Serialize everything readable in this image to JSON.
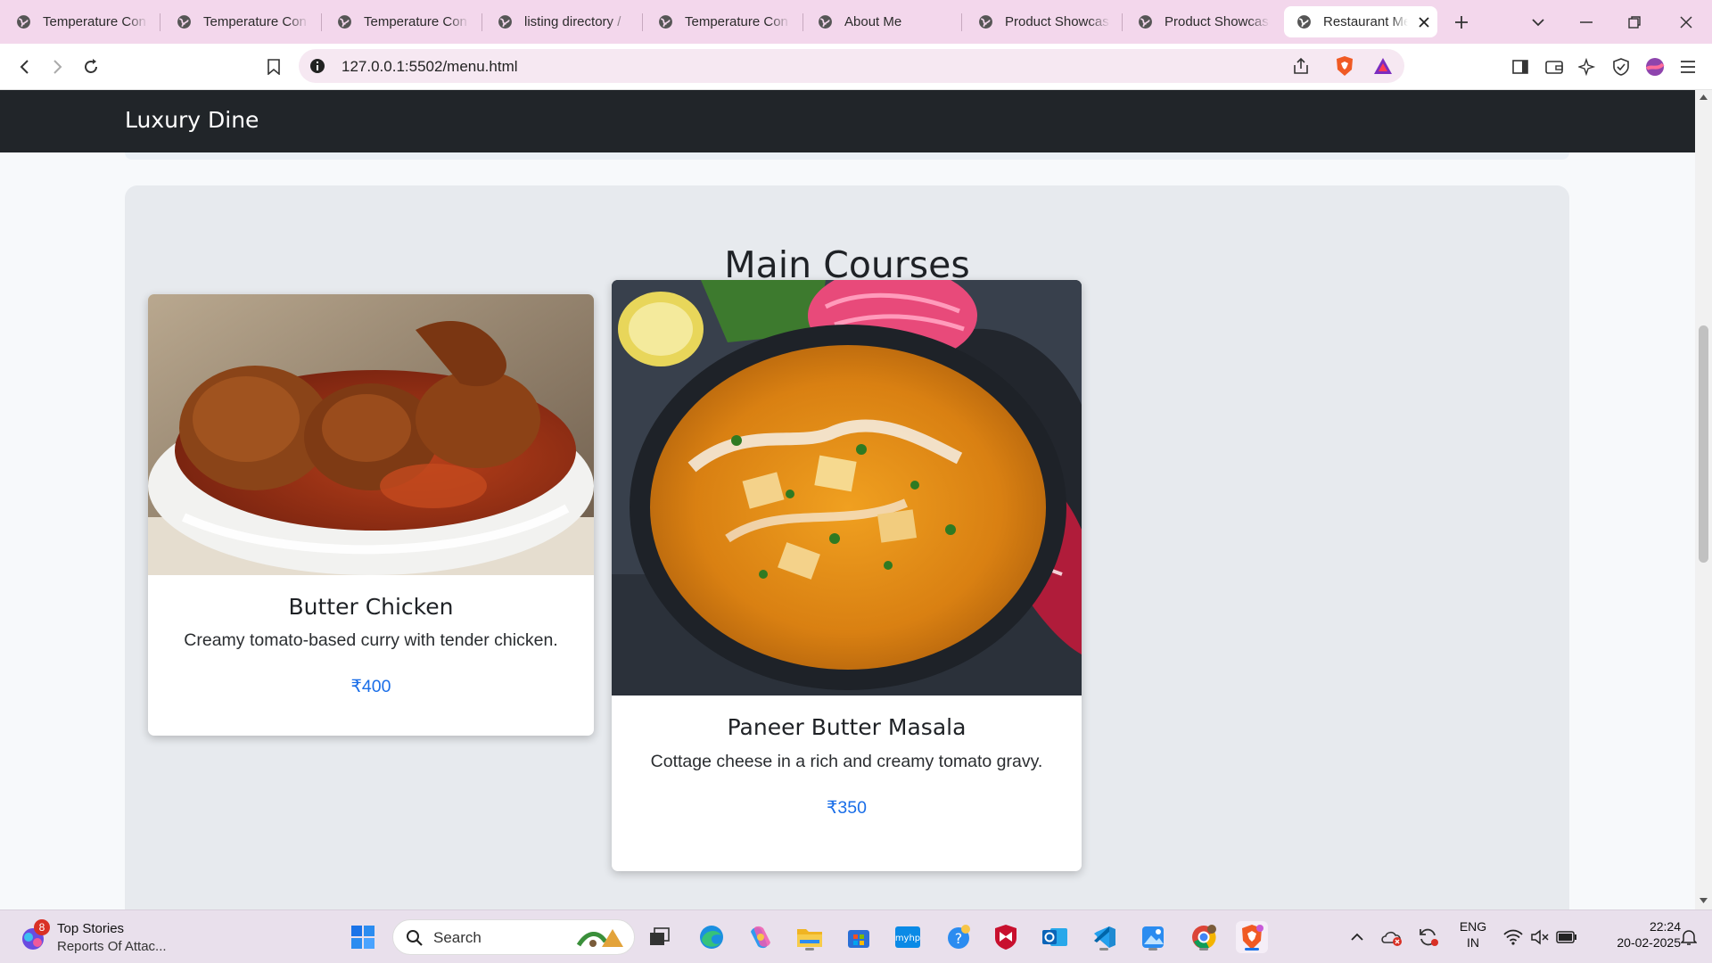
{
  "browser": {
    "tabs": [
      {
        "title": "Temperature Con"
      },
      {
        "title": "Temperature Con"
      },
      {
        "title": "Temperature Con"
      },
      {
        "title": "listing directory /"
      },
      {
        "title": "Temperature Con"
      },
      {
        "title": "About Me"
      },
      {
        "title": "Product Showcase"
      },
      {
        "title": "Product Showcase"
      },
      {
        "title": "Restaurant Menu",
        "active": true
      }
    ],
    "address": "127.0.0.1:5502/menu.html"
  },
  "page": {
    "brand": "Luxury Dine",
    "section_title": "Main Courses",
    "items": [
      {
        "name": "Butter Chicken",
        "description": "Creamy tomato-based curry with tender chicken.",
        "price": "₹400"
      },
      {
        "name": "Paneer Butter Masala",
        "description": "Cottage cheese in a rich and creamy tomato gravy.",
        "price": "₹350"
      }
    ],
    "colors": {
      "navbar": "#212529",
      "price": "#1a6ee8",
      "section_bg": "#e7eaee"
    }
  },
  "taskbar": {
    "news_badge": "8",
    "news_title": "Top Stories",
    "news_subtitle": "Reports Of Attac...",
    "search_label": "Search",
    "lang_top": "ENG",
    "lang_bottom": "IN",
    "time": "22:24",
    "date": "20-02-2025",
    "icons": [
      "windows-start-icon",
      "search-icon",
      "task-view-icon",
      "edge-icon",
      "copilot-icon",
      "file-explorer-icon",
      "store-icon",
      "myhp-icon",
      "help-icon",
      "mcafee-icon",
      "outlook-icon",
      "vscode-icon",
      "photos-icon",
      "chrome-icon",
      "brave-icon"
    ]
  }
}
